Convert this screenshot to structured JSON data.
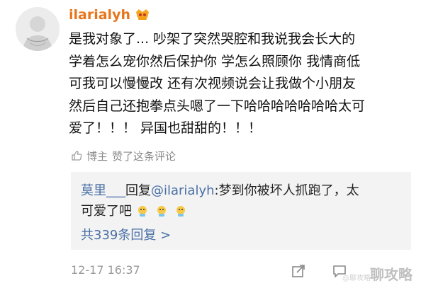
{
  "comment": {
    "username": "ilarialyh",
    "lines": [
      "是我对象了... 吵架了突然哭腔和我说我会长大的",
      "学着怎么宠你然后保护你 学怎么照顾你 我情商低",
      "可我可以慢慢改 还有次视频说会让我做个小朋友",
      "然后自己还抱拳点头嗯了一下哈哈哈哈哈哈哈太可",
      "爱了！！！ 异国也甜甜的！！！"
    ],
    "liked_by": "博主",
    "liked_text": "赞了这条评论",
    "timestamp": "12-17 16:37"
  },
  "reply": {
    "author": "莫里___",
    "action": "回复",
    "mention": "@ilarialyh",
    "text_line1": ":梦到你被坏人抓跑了，太",
    "text_line2": "可爱了吧",
    "more": "共339条回复 >"
  },
  "icons": {
    "avatar": "avatar",
    "vip": "vip-badge-icon",
    "thumb": "thumbs-up-icon",
    "emoji": "crying-emoji-icon",
    "share": "share-icon",
    "comment": "comment-icon"
  },
  "watermark": {
    "main": "聊攻略",
    "small": "@聊攻略"
  },
  "colors": {
    "username": "#e8751a",
    "link": "#4a6fa5",
    "muted": "#8a8a8a",
    "reply_bg": "#f3f3f3"
  }
}
